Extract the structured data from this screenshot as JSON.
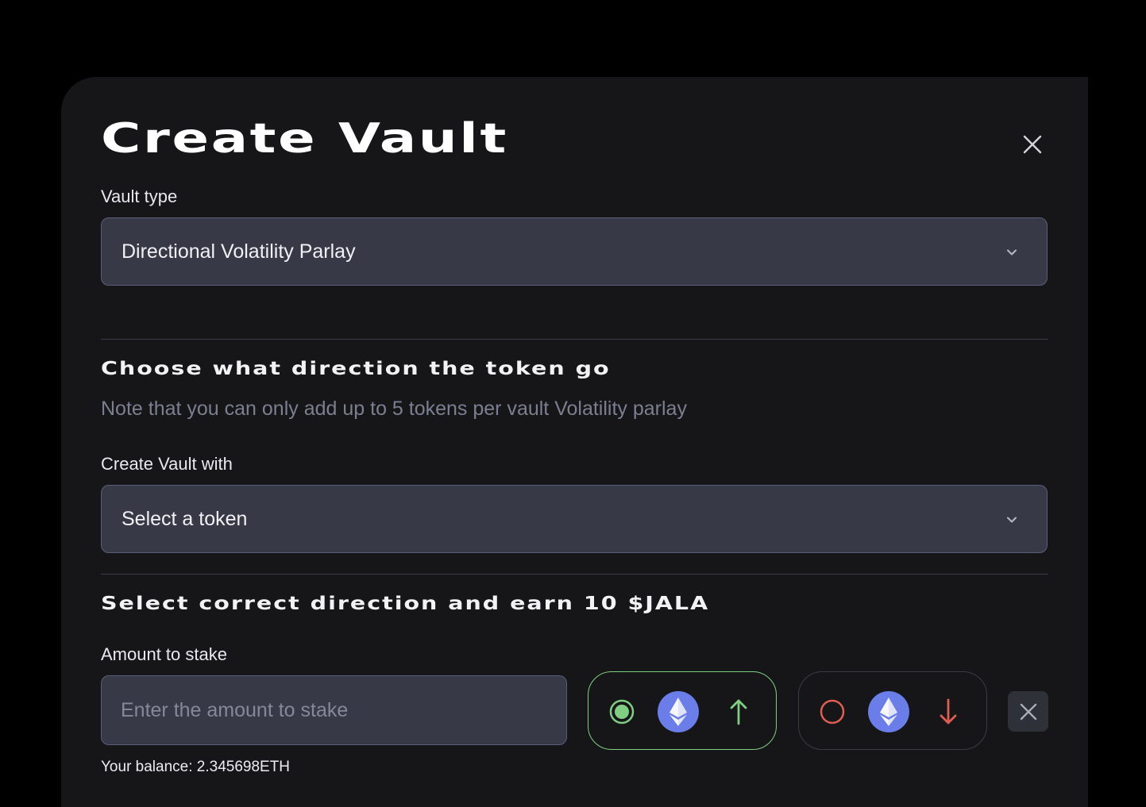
{
  "modal": {
    "title": "Create Vault",
    "close_icon": "close-icon"
  },
  "vault_type": {
    "label": "Vault type",
    "value": "Directional Volatility  Parlay",
    "icon": "chevron-down-icon"
  },
  "direction_section": {
    "heading": "Choose what direction the token go",
    "note": "Note that you can only add up to 5 tokens per vault Volatility parlay"
  },
  "create_with": {
    "label": "Create Vault with",
    "value": "Select a token",
    "icon": "chevron-down-icon"
  },
  "earn_section": {
    "heading": "Select correct direction and earn 10 $JALA"
  },
  "stake": {
    "label": "Amount to stake",
    "placeholder": "Enter the amount to stake",
    "value": "",
    "balance": "Your balance: 2.345698ETH"
  },
  "direction_options": [
    {
      "direction": "up",
      "selected": true,
      "token_icon": "eth-icon",
      "arrow_icon": "arrow-up-icon",
      "color": "#7fce82"
    },
    {
      "direction": "down",
      "selected": false,
      "token_icon": "eth-icon",
      "arrow_icon": "arrow-down-icon",
      "color": "#e05d52"
    }
  ],
  "remove_icon": "close-icon",
  "colors": {
    "background": "#000000",
    "panel": "#161619",
    "field": "#373946",
    "field_border": "#5a5d78",
    "up": "#7fce82",
    "down": "#e05d52",
    "eth": "#6b7de8"
  }
}
